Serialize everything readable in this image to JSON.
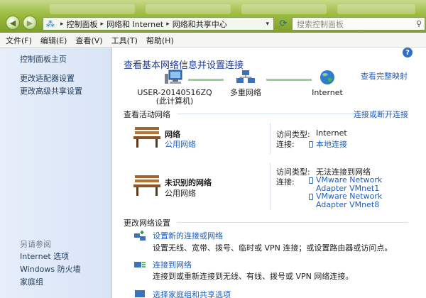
{
  "address_bar": {
    "breadcrumb": [
      "控制面板",
      "网络和 Internet",
      "网络和共享中心"
    ],
    "search_placeholder": "搜索控制面板"
  },
  "menu": [
    "文件(F)",
    "编辑(E)",
    "查看(V)",
    "工具(T)",
    "帮助(H)"
  ],
  "sidebar": {
    "top_links": [
      "控制面板主页",
      "更改适配器设置",
      "更改高级共享设置"
    ],
    "see_also_label": "另请参阅",
    "see_also_links": [
      "Internet 选项",
      "Windows 防火墙",
      "家庭组"
    ]
  },
  "main": {
    "title": "查看基本网络信息并设置连接",
    "full_map_link": "查看完整映射",
    "map_nodes": [
      {
        "label": "USER-20140516ZQ",
        "sublabel": "(此计算机)"
      },
      {
        "label": "多重网络",
        "sublabel": ""
      },
      {
        "label": "Internet",
        "sublabel": ""
      }
    ],
    "active_section_title": "查看活动网络",
    "connect_disconnect_link": "连接或断开连接",
    "networks": [
      {
        "name": "网络",
        "type": "公用网络",
        "type_is_link": true,
        "access_label": "访问类型:",
        "access_value": "Internet",
        "conn_label": "连接:",
        "connections": [
          "本地连接"
        ]
      },
      {
        "name": "未识别的网络",
        "type": "公用网络",
        "type_is_link": false,
        "access_label": "访问类型:",
        "access_value": "无法连接到网络",
        "conn_label": "连接:",
        "connections": [
          "VMware Network Adapter VMnet1",
          "VMware Network Adapter VMnet8"
        ]
      }
    ],
    "change_section_title": "更改网络设置",
    "tasks": [
      {
        "title": "设置新的连接或网络",
        "desc": "设置无线、宽带、拨号、临时或 VPN 连接；或设置路由器或访问点。"
      },
      {
        "title": "连接到网络",
        "desc": "连接到或重新连接到无线、有线、拨号或 VPN 网络连接。"
      },
      {
        "title": "选择家庭组和共享选项",
        "desc": ""
      }
    ]
  },
  "colors": {
    "link": "#1f5ebe",
    "title": "#1f3d9c",
    "titlebar_green": "#9cbc3f",
    "sidebar_bg": "#dfe8f8"
  }
}
